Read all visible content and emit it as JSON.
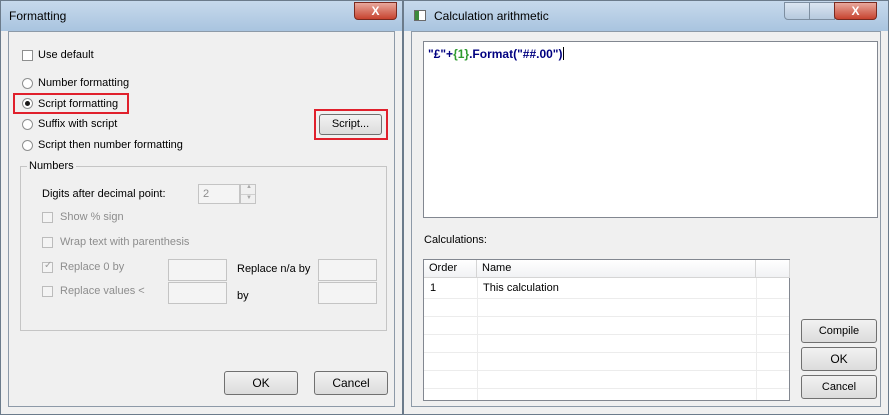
{
  "formatting": {
    "title": "Formatting",
    "close_glyph": "X",
    "use_default": "Use default",
    "number_formatting": "Number formatting",
    "script_formatting": "Script formatting",
    "suffix_with_script": "Suffix with script",
    "script_then_number": "Script then number formatting",
    "script_button": "Script...",
    "numbers_group": "Numbers",
    "digits_label": "Digits after decimal point:",
    "digits_value": "2",
    "show_percent": "Show % sign",
    "wrap_parenthesis": "Wrap text with parenthesis",
    "replace_zero": "Replace 0 by",
    "replace_na": "Replace n/a by",
    "replace_values": "Replace values <",
    "by": "by",
    "ok": "OK",
    "cancel": "Cancel"
  },
  "calc": {
    "title": "Calculation arithmetic",
    "close_glyph": "X",
    "code": {
      "part1": "\"£\"+",
      "part2": "{1}",
      "part3": ".Format",
      "part4": "(\"##.00\")"
    },
    "calculations_label": "Calculations:",
    "columns": {
      "order": "Order",
      "name": "Name"
    },
    "rows": [
      {
        "order": "1",
        "name": "This calculation"
      }
    ],
    "compile": "Compile",
    "ok": "OK",
    "cancel": "Cancel"
  },
  "colors": {
    "highlight": "#e0202c",
    "code_string": "#000080",
    "code_var": "#2e9a2e",
    "code_method": "#000080"
  }
}
